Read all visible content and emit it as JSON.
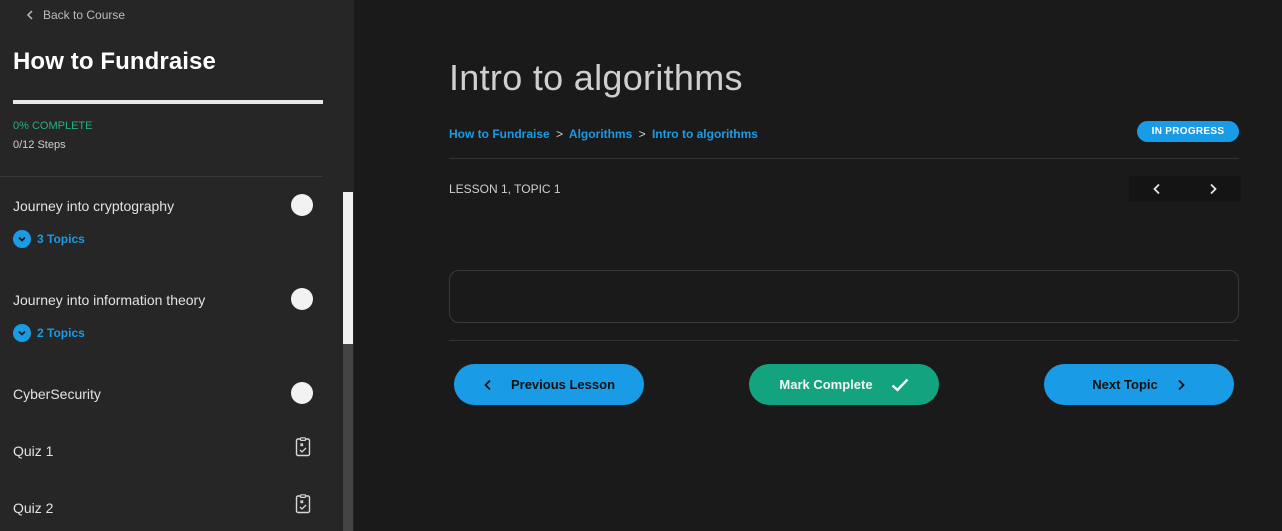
{
  "sidebar": {
    "back_label": "Back to Course",
    "course_title": "How to Fundraise",
    "progress": {
      "percent": 0,
      "percent_label": "0% COMPLETE",
      "steps_label": "0/12 Steps"
    },
    "lessons": [
      {
        "title": "Journey into cryptography",
        "topics_label": "3 Topics"
      },
      {
        "title": "Journey into information theory",
        "topics_label": "2 Topics"
      },
      {
        "title": "CyberSecurity"
      },
      {
        "title": "Quiz 1"
      },
      {
        "title": "Quiz 2"
      }
    ]
  },
  "main": {
    "title": "Intro to algorithms",
    "breadcrumb": {
      "course": "How to Fundraise",
      "lesson": "Algorithms",
      "topic": "Intro to algorithms",
      "separator": ">"
    },
    "status_badge": "IN PROGRESS",
    "lesson_topic_label": "LESSON 1, TOPIC 1",
    "buttons": {
      "previous": "Previous Lesson",
      "mark_complete": "Mark Complete",
      "next": "Next Topic"
    }
  },
  "colors": {
    "accent_blue": "#1a9be6",
    "accent_green": "#14a37f",
    "sidebar_bg": "#262626",
    "main_bg": "#1a1a1a"
  }
}
